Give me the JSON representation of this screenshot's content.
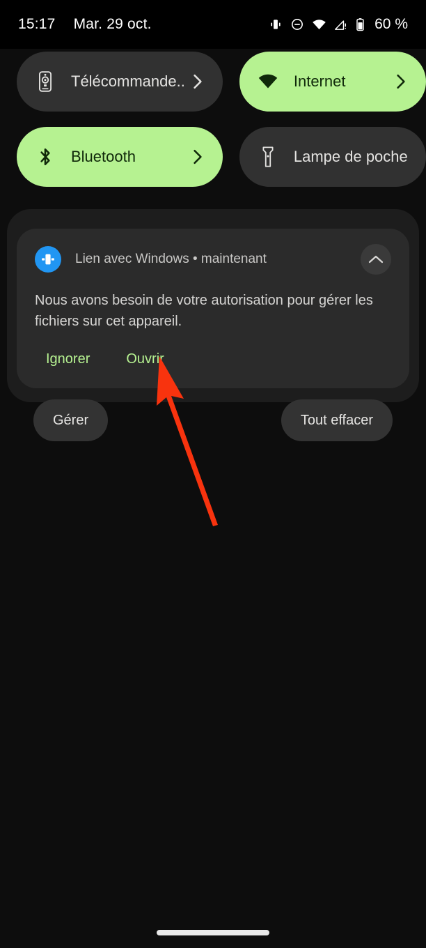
{
  "status_bar": {
    "time": "15:17",
    "date": "Mar. 29 oct.",
    "battery_text": "60 %",
    "icons": [
      "vibrate-icon",
      "do-not-disturb-icon",
      "wifi-icon",
      "cell-signal-warning-icon",
      "battery-icon"
    ]
  },
  "quick_settings": {
    "tiles": [
      {
        "label": "Télécommande..",
        "icon": "remote-control-icon",
        "active": false,
        "has_chevron": true
      },
      {
        "label": "Internet",
        "icon": "wifi-icon",
        "active": true,
        "has_chevron": true
      },
      {
        "label": "Bluetooth",
        "icon": "bluetooth-icon",
        "active": true,
        "has_chevron": true
      },
      {
        "label": "Lampe de poche",
        "icon": "flashlight-icon",
        "active": false,
        "has_chevron": false
      }
    ]
  },
  "notification": {
    "app_icon": "link-to-windows-icon",
    "title": "Lien avec Windows • maintenant",
    "body": "Nous avons besoin de votre autorisation pour gérer les fichiers sur cet appareil.",
    "collapse_icon": "chevron-up-icon",
    "actions": [
      {
        "label": "Ignorer"
      },
      {
        "label": "Ouvrir"
      }
    ]
  },
  "footer": {
    "manage_label": "Gérer",
    "clear_all_label": "Tout effacer"
  },
  "annotation": {
    "arrow_color": "#f8330e",
    "points_to": "Ouvrir"
  },
  "colors": {
    "background": "#0d0d0d",
    "tile_inactive": "#313131",
    "tile_active": "#b6f291",
    "tile_active_text": "#10290a",
    "notification_group": "#1d1d1d",
    "notification_card": "#2b2b2b",
    "accent_green": "#b6f291",
    "app_icon_blue": "#2196f3"
  },
  "nav": {
    "home_indicator": "home-gesture-bar"
  }
}
